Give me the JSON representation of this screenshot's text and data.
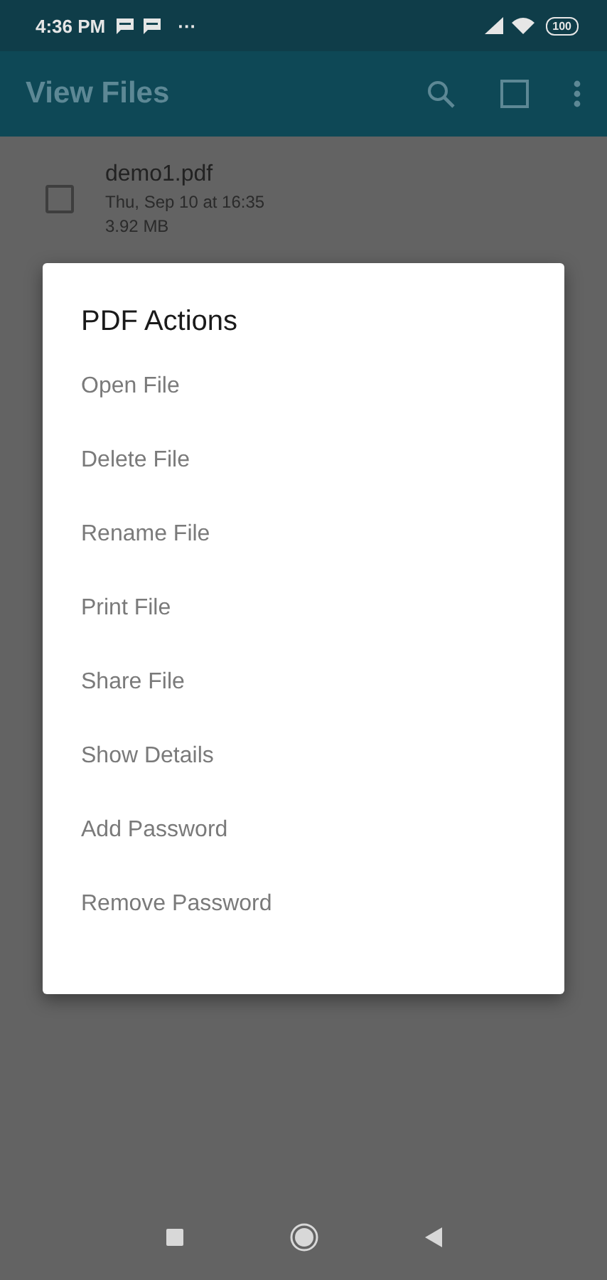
{
  "status_bar": {
    "time": "4:36 PM",
    "more": "···",
    "battery": "100"
  },
  "app_bar": {
    "title": "View Files"
  },
  "files": [
    {
      "name": "demo1.pdf",
      "date": "Thu, Sep 10 at 16:35",
      "size": "3.92 MB",
      "checked": false
    }
  ],
  "dialog": {
    "title": "PDF Actions",
    "items": [
      "Open File",
      "Delete File",
      "Rename File",
      "Print File",
      "Share File",
      "Show Details",
      "Add Password",
      "Remove Password"
    ]
  }
}
